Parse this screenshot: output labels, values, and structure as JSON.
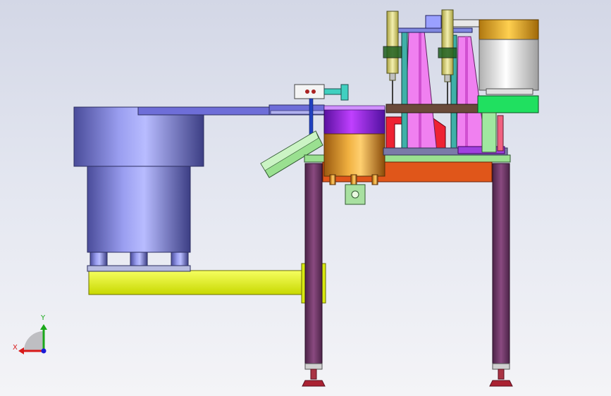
{
  "viewport": {
    "type": "CAD 3D model view (assembly, front view)",
    "background": [
      "#d3d7e6",
      "#f4f4f7"
    ]
  },
  "triad": {
    "x_label": "X",
    "y_label": "Y",
    "x_color": "#d81a1a",
    "y_color": "#1aa81a",
    "z_color": "#1a1ad8"
  },
  "parts": {
    "bowl_feeder_color": "#8a8ee0",
    "track_color": "#6a6ad0",
    "base_beam_color": "#e8ff1a",
    "frame_legs_color": "#7a4070",
    "table_top_color": "#e0561a",
    "gold_hopper_color": "#e6a23a",
    "purple_lid_color": "#a020f0",
    "pink_column_color": "#f080f0",
    "green_plate_color": "#20e060",
    "drum_color": "#f0f0f0"
  }
}
